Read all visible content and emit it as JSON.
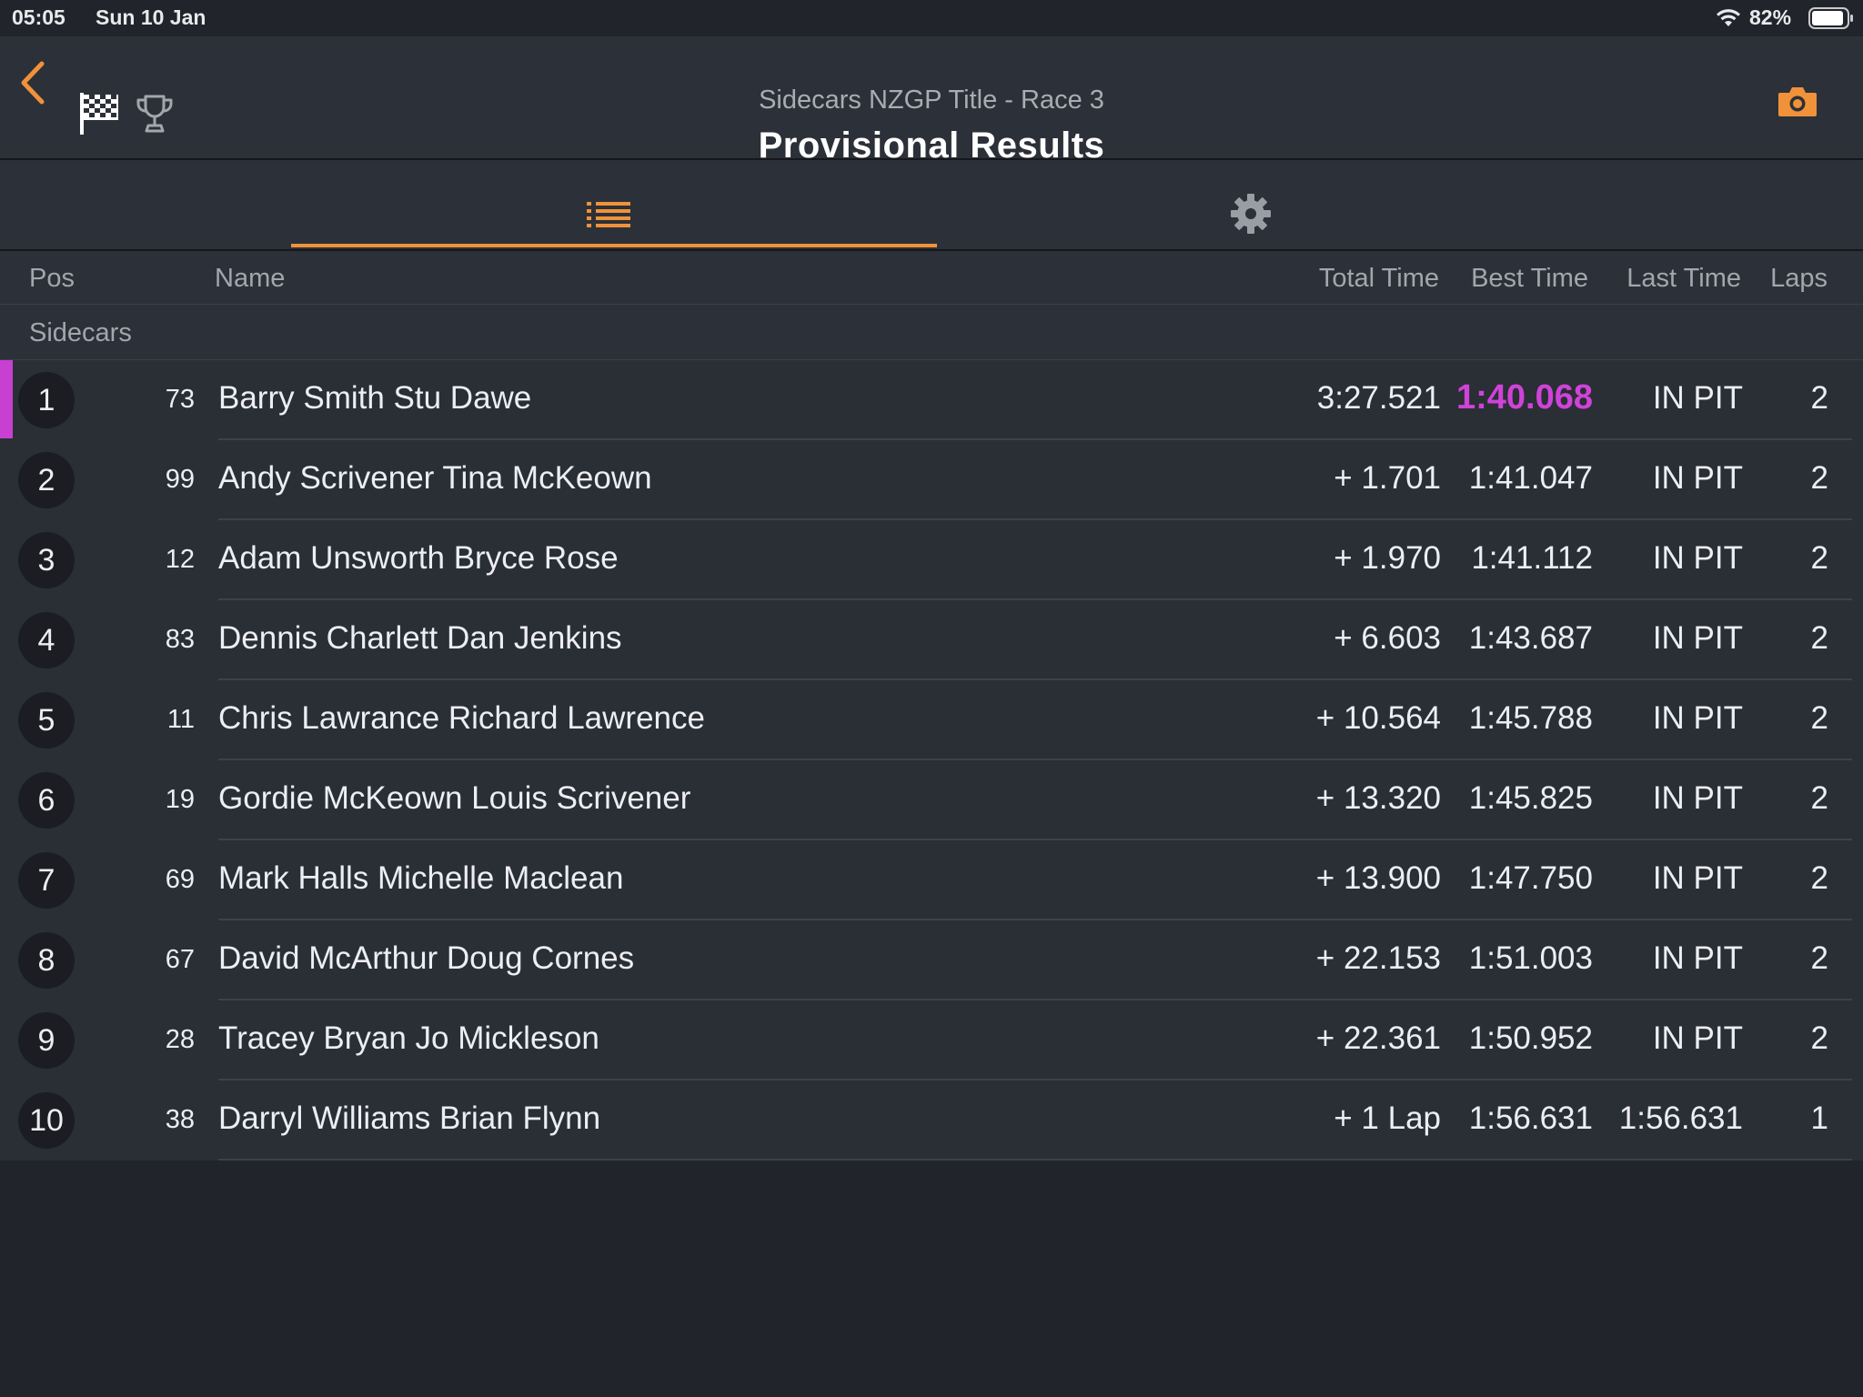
{
  "status_bar": {
    "time": "05:05",
    "date": "Sun 10 Jan",
    "battery": "82%"
  },
  "header": {
    "subtitle": "Sidecars NZGP Title - Race 3",
    "title": "Provisional Results"
  },
  "colors": {
    "accent": "#f0923a",
    "fastest_lap": "#cf43d8",
    "background": "#21242b"
  },
  "tabs": [
    {
      "name": "results",
      "icon": "list-icon",
      "active": true
    },
    {
      "name": "settings",
      "icon": "gear-icon",
      "active": false
    }
  ],
  "columns": {
    "pos": "Pos",
    "name": "Name",
    "total": "Total Time",
    "best": "Best Time",
    "last": "Last Time",
    "laps": "Laps"
  },
  "group": "Sidecars",
  "rows": [
    {
      "pos": "1",
      "number": "73",
      "name": "Barry Smith Stu Dawe",
      "total": "3:27.521",
      "best": "1:40.068",
      "last": "IN PIT",
      "laps": "2",
      "fastest": true
    },
    {
      "pos": "2",
      "number": "99",
      "name": "Andy Scrivener Tina McKeown",
      "total": "+ 1.701",
      "best": "1:41.047",
      "last": "IN PIT",
      "laps": "2"
    },
    {
      "pos": "3",
      "number": "12",
      "name": "Adam Unsworth Bryce Rose",
      "total": "+ 1.970",
      "best": "1:41.112",
      "last": "IN PIT",
      "laps": "2"
    },
    {
      "pos": "4",
      "number": "83",
      "name": "Dennis Charlett Dan Jenkins",
      "total": "+ 6.603",
      "best": "1:43.687",
      "last": "IN PIT",
      "laps": "2"
    },
    {
      "pos": "5",
      "number": "11",
      "name": "Chris Lawrance Richard Lawrence",
      "total": "+ 10.564",
      "best": "1:45.788",
      "last": "IN PIT",
      "laps": "2"
    },
    {
      "pos": "6",
      "number": "19",
      "name": "Gordie McKeown Louis Scrivener",
      "total": "+ 13.320",
      "best": "1:45.825",
      "last": "IN PIT",
      "laps": "2"
    },
    {
      "pos": "7",
      "number": "69",
      "name": "Mark Halls Michelle Maclean",
      "total": "+ 13.900",
      "best": "1:47.750",
      "last": "IN PIT",
      "laps": "2"
    },
    {
      "pos": "8",
      "number": "67",
      "name": "David McArthur Doug Cornes",
      "total": "+ 22.153",
      "best": "1:51.003",
      "last": "IN PIT",
      "laps": "2"
    },
    {
      "pos": "9",
      "number": "28",
      "name": "Tracey Bryan Jo Mickleson",
      "total": "+ 22.361",
      "best": "1:50.952",
      "last": "IN PIT",
      "laps": "2"
    },
    {
      "pos": "10",
      "number": "38",
      "name": "Darryl Williams Brian Flynn",
      "total": "+ 1 Lap",
      "best": "1:56.631",
      "last": "1:56.631",
      "laps": "1"
    }
  ]
}
